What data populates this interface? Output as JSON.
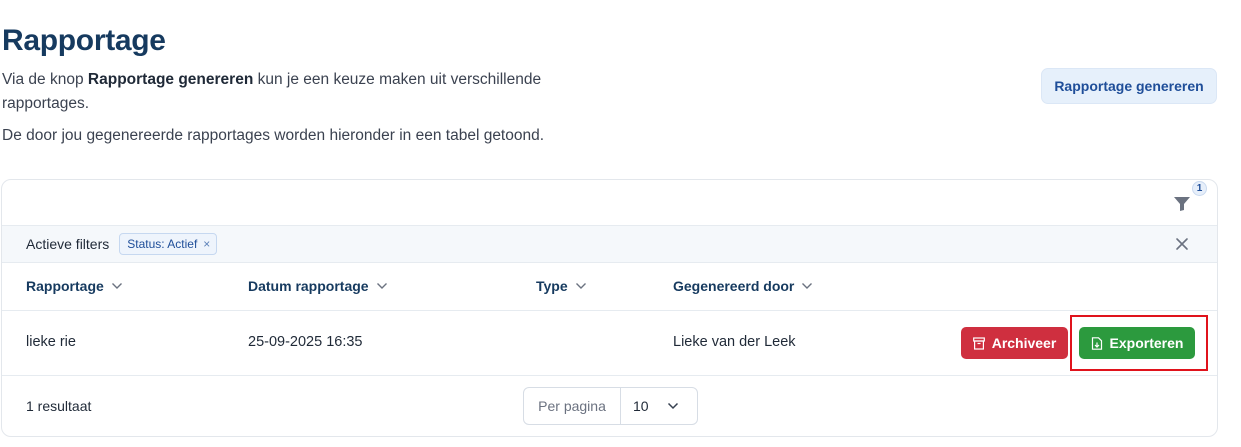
{
  "page": {
    "title": "Rapportage",
    "intro_prefix": "Via de knop ",
    "intro_bold": "Rapportage genereren",
    "intro_suffix": " kun je een keuze maken uit verschillende rapportages.",
    "intro_second": "De door jou gegenereerde rapportages worden hieronder in een tabel getoond.",
    "generate_button": "Rapportage genereren"
  },
  "filters": {
    "badge_count": "1",
    "label": "Actieve filters",
    "chips": [
      {
        "label": "Status: Actief",
        "remove": "×"
      }
    ]
  },
  "table": {
    "columns": [
      "Rapportage",
      "Datum rapportage",
      "Type",
      "Gegenereerd door"
    ],
    "rows": [
      {
        "rapportage": "lieke rie",
        "datum": "25-09-2025 16:35",
        "type": "",
        "gegenereerd_door": "Lieke van der Leek",
        "archive_label": "Archiveer",
        "export_label": "Exporteren"
      }
    ]
  },
  "footer": {
    "results": "1 resultaat",
    "per_page_label": "Per pagina",
    "per_page_value": "10"
  },
  "colors": {
    "title": "#163a5f",
    "archive": "#cf2f3f",
    "export": "#2c9a3e",
    "highlight": "#e0131c"
  },
  "icons": [
    "filter-icon",
    "close-icon",
    "chevron-down-icon",
    "archive-icon",
    "file-export-icon"
  ]
}
